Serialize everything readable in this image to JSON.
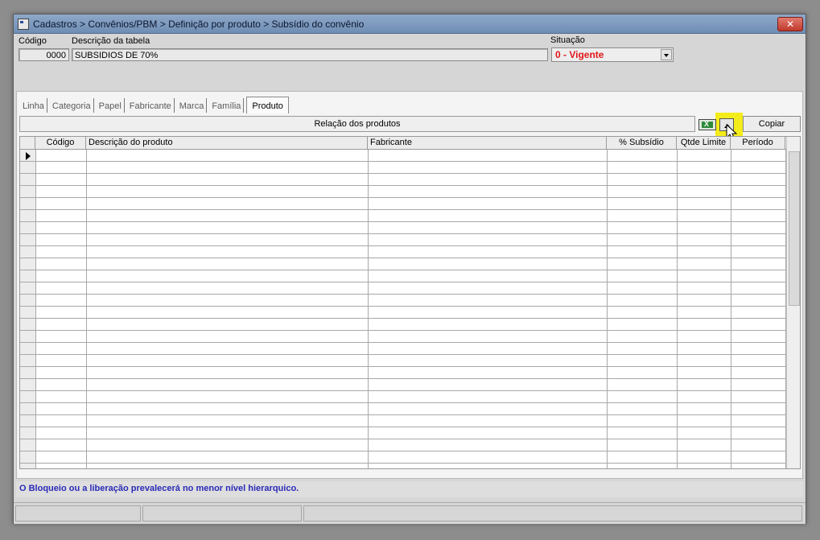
{
  "window": {
    "title": "Cadastros > Convênios/PBM > Definição por produto > Subsídio do convênio",
    "close_label": "✕"
  },
  "header": {
    "codigo_label": "Código",
    "codigo_value": "0000",
    "descricao_label": "Descrição da tabela",
    "descricao_value": "SUBSIDIOS DE 70%",
    "situacao_label": "Situação",
    "situacao_value": "0 - Vigente",
    "situacao_color": "#e0161a"
  },
  "tabs": [
    {
      "label": "Linha"
    },
    {
      "label": "Categoria"
    },
    {
      "label": "Papel"
    },
    {
      "label": "Fabricante"
    },
    {
      "label": "Marca"
    },
    {
      "label": "Família"
    },
    {
      "label": "Produto",
      "active": true
    }
  ],
  "toolbar": {
    "relacao_label": "Relação dos produtos",
    "excel_icon": "excel-icon",
    "expand_icon": "expand-up-icon",
    "copy_label": "Copiar",
    "highlight_color": "#f4ec1a"
  },
  "grid": {
    "columns": [
      {
        "label": "Código"
      },
      {
        "label": "Descrição do produto"
      },
      {
        "label": "Fabricante"
      },
      {
        "label": "% Subsídio"
      },
      {
        "label": "Qtde Limite"
      },
      {
        "label": "Período"
      }
    ],
    "rows": [],
    "current_row_indicator": "row-pointer-icon"
  },
  "status": {
    "message": "O Bloqueio ou a liberação prevalecerá no menor nível hierarquico.",
    "message_color": "#2a2ab8"
  }
}
